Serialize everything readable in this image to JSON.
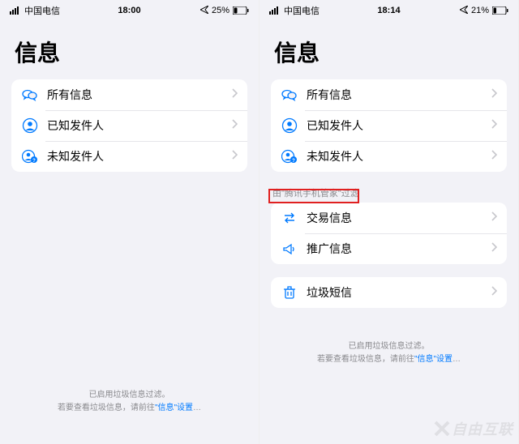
{
  "left": {
    "status": {
      "carrier": "中国电信",
      "time": "18:00",
      "battery": "25%"
    },
    "title": "信息",
    "group1": [
      {
        "label": "所有信息"
      },
      {
        "label": "已知发件人"
      },
      {
        "label": "未知发件人"
      }
    ],
    "footer": {
      "line1": "已启用垃圾信息过滤。",
      "line2a": "若要查看垃圾信息，请前往",
      "line2link": "\"信息\"设置",
      "line2b": "…"
    }
  },
  "right": {
    "status": {
      "carrier": "中国电信",
      "time": "18:14",
      "battery": "21%"
    },
    "title": "信息",
    "group1": [
      {
        "label": "所有信息"
      },
      {
        "label": "已知发件人"
      },
      {
        "label": "未知发件人"
      }
    ],
    "section_label": "由\"腾讯手机管家\"过滤",
    "group2": [
      {
        "label": "交易信息"
      },
      {
        "label": "推广信息"
      }
    ],
    "group3": [
      {
        "label": "垃圾短信"
      }
    ],
    "footer": {
      "line1": "已启用垃圾信息过滤。",
      "line2a": "若要查看垃圾信息，请前往",
      "line2link": "\"信息\"设置",
      "line2b": "…"
    }
  },
  "watermark": "自由互联",
  "colors": {
    "accent": "#007aff",
    "highlight": "#e02020"
  }
}
